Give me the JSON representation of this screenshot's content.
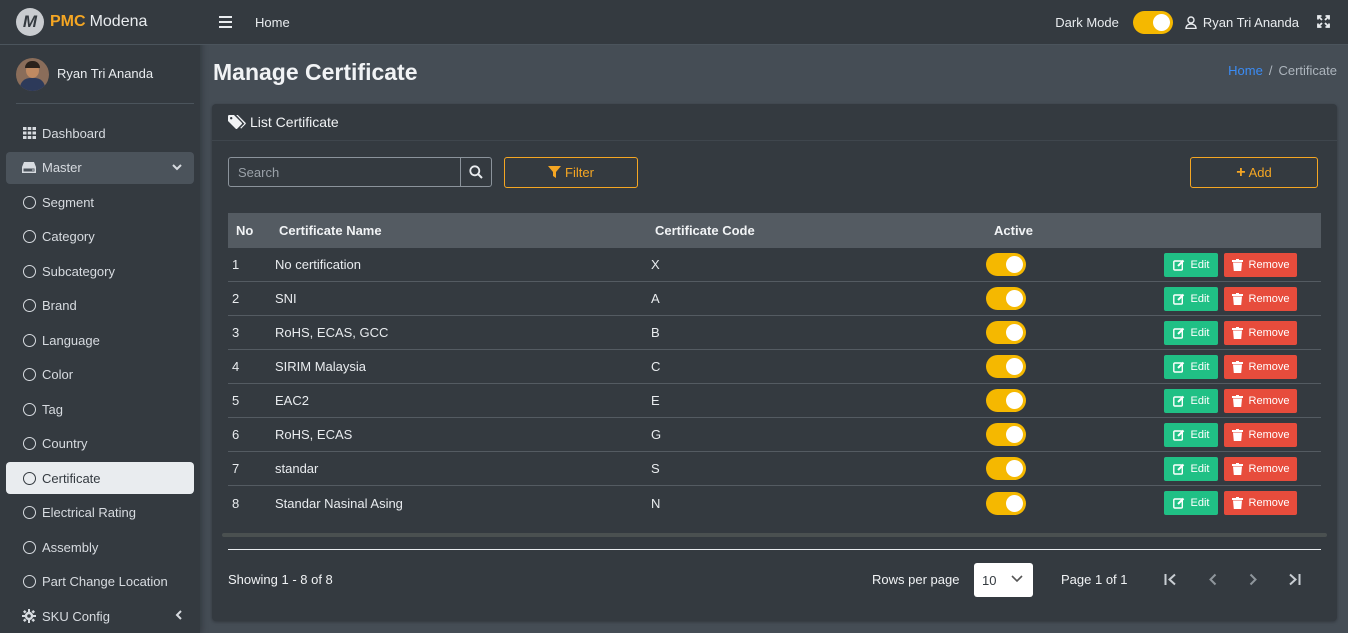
{
  "brand": {
    "name_a": "PMC",
    "name_b": "Modena",
    "logo_letter": "M"
  },
  "sidebar": {
    "user_name": "Ryan Tri Ananda",
    "items": [
      {
        "label": "Dashboard",
        "icon": "grid-icon"
      },
      {
        "label": "Master",
        "icon": "drive-icon"
      },
      {
        "label": "Segment",
        "icon": "circle-icon"
      },
      {
        "label": "Category",
        "icon": "circle-icon"
      },
      {
        "label": "Subcategory",
        "icon": "circle-icon"
      },
      {
        "label": "Brand",
        "icon": "circle-icon"
      },
      {
        "label": "Language",
        "icon": "circle-icon"
      },
      {
        "label": "Color",
        "icon": "circle-icon"
      },
      {
        "label": "Tag",
        "icon": "circle-icon"
      },
      {
        "label": "Country",
        "icon": "circle-icon"
      },
      {
        "label": "Certificate",
        "icon": "circle-icon"
      },
      {
        "label": "Electrical Rating",
        "icon": "circle-icon"
      },
      {
        "label": "Assembly",
        "icon": "circle-icon"
      },
      {
        "label": "Part Change Location",
        "icon": "circle-icon"
      },
      {
        "label": "SKU Config",
        "icon": "gear-icon"
      }
    ]
  },
  "topbar": {
    "home": "Home",
    "dark_mode_label": "Dark Mode",
    "dark_mode_on": true,
    "user_name": "Ryan Tri Ananda"
  },
  "page": {
    "title": "Manage Certificate",
    "breadcrumb": {
      "home": "Home",
      "separator": "/",
      "current": "Certificate"
    }
  },
  "card": {
    "header": "List Certificate",
    "search_placeholder": "Search",
    "filter_label": "Filter",
    "add_label": "Add",
    "columns": {
      "no": "No",
      "name": "Certificate Name",
      "code": "Certificate Code",
      "active": "Active"
    },
    "edit_label": "Edit",
    "remove_label": "Remove",
    "rows": [
      {
        "no": "1",
        "name": "No certification",
        "code": "X",
        "active": true
      },
      {
        "no": "2",
        "name": "SNI",
        "code": "A",
        "active": true
      },
      {
        "no": "3",
        "name": "RoHS, ECAS, GCC",
        "code": "B",
        "active": true
      },
      {
        "no": "4",
        "name": "SIRIM Malaysia",
        "code": "C",
        "active": true
      },
      {
        "no": "5",
        "name": "EAC2",
        "code": "E",
        "active": true
      },
      {
        "no": "6",
        "name": "RoHS, ECAS",
        "code": "G",
        "active": true
      },
      {
        "no": "7",
        "name": "standar",
        "code": "S",
        "active": true
      },
      {
        "no": "8",
        "name": "Standar Nasinal Asing",
        "code": "N",
        "active": true
      }
    ],
    "footer": {
      "showing": "Showing 1 - 8 of 8",
      "rows_per_page_label": "Rows per page",
      "rows_per_page_value": "10",
      "page_info": "Page 1 of 1"
    }
  },
  "colors": {
    "accent": "#f5a623",
    "toggle": "#f5b800",
    "edit": "#20c085",
    "remove": "#e74c3c",
    "link": "#3b8cf5"
  }
}
